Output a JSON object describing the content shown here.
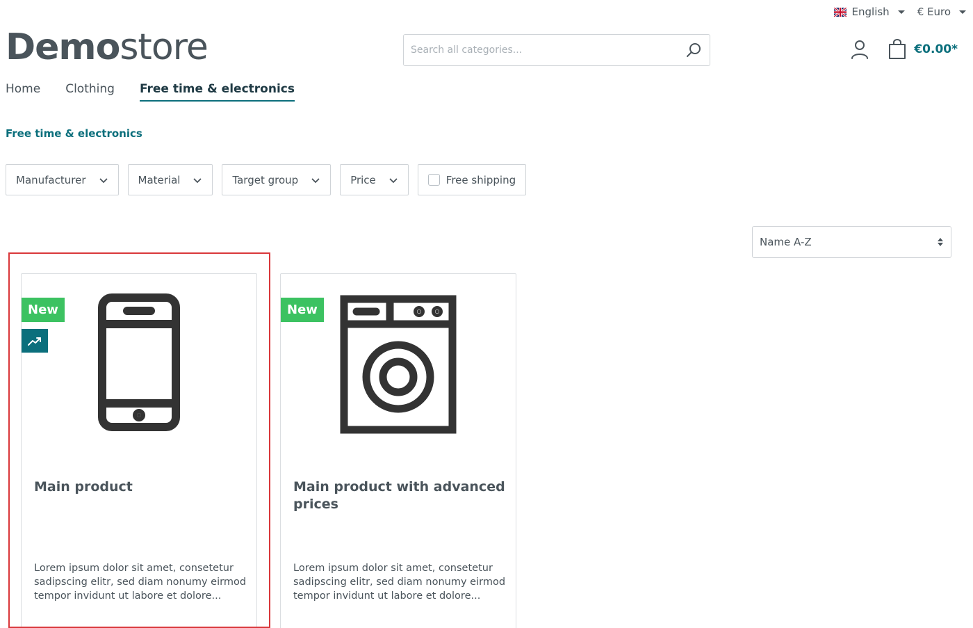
{
  "topbar": {
    "language": "English",
    "currency": "€ Euro"
  },
  "logo": {
    "bold": "Demo",
    "light": "store"
  },
  "search": {
    "placeholder": "Search all categories..."
  },
  "cart": {
    "total": "€0.00*"
  },
  "nav": {
    "items": [
      {
        "label": "Home",
        "active": false
      },
      {
        "label": "Clothing",
        "active": false
      },
      {
        "label": "Free time & electronics",
        "active": true
      }
    ]
  },
  "breadcrumb": "Free time & electronics",
  "filters": {
    "manufacturer": "Manufacturer",
    "material": "Material",
    "target_group": "Target group",
    "price": "Price",
    "free_shipping": "Free shipping"
  },
  "sort": {
    "selected": "Name A-Z"
  },
  "products": [
    {
      "badge": "New",
      "topseller": true,
      "icon": "smartphone-icon",
      "title": "Main product",
      "description": "Lorem ipsum dolor sit amet, consetetur sadipscing elitr, sed diam nonumy eirmod tempor invidunt ut labore et dolore..."
    },
    {
      "badge": "New",
      "topseller": false,
      "icon": "washing-machine-icon",
      "title": "Main product with advanced prices",
      "description": "Lorem ipsum dolor sit amet, consetetur sadipscing elitr, sed diam nonumy eirmod tempor invidunt ut labore et dolore..."
    }
  ],
  "colors": {
    "accent": "#0b6f7c",
    "new_badge": "#3cc261",
    "highlight": "#d9373a",
    "text": "#4a545b"
  }
}
